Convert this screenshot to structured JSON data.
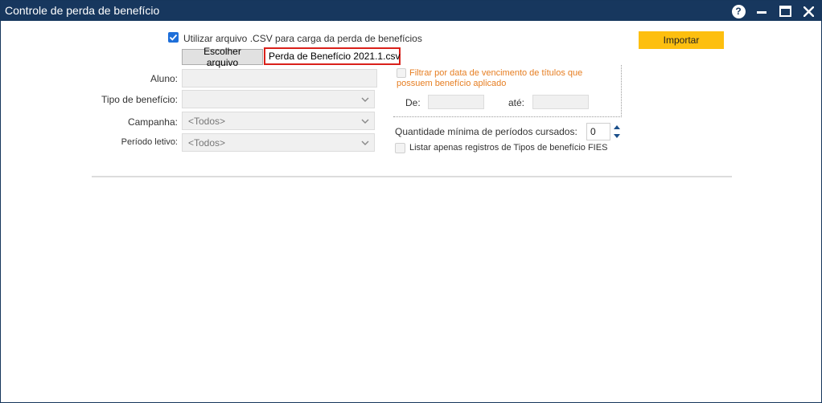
{
  "window": {
    "title": "Controle de perda de benefício"
  },
  "csv": {
    "use_csv_label": "Utilizar arquivo .CSV para carga da perda de benefícios",
    "use_csv_checked": true,
    "choose_button": "Escolher arquivo",
    "file_name": "Perda de Benefício 2021.1.csv"
  },
  "form": {
    "aluno_label": "Aluno:",
    "aluno_value": "",
    "tipo_label": "Tipo de benefício:",
    "tipo_value": "",
    "campanha_label": "Campanha:",
    "campanha_value": "<Todos>",
    "periodo_label": "Período letivo:",
    "periodo_value": "<Todos>"
  },
  "filter": {
    "label": "Filtrar por data de vencimento de títulos que possuem benefício aplicado",
    "de_label": "De:",
    "ate_label": "até:",
    "de_value": "",
    "ate_value": ""
  },
  "min_periods": {
    "label": "Quantidade mínima de períodos cursados:",
    "value": "0"
  },
  "fies": {
    "label": "Listar apenas registros de Tipos de benefício FIES"
  },
  "actions": {
    "import_label": "Importar"
  },
  "colors": {
    "titlebar": "#17375e",
    "accent": "#fdbf0f",
    "highlight_border": "#d9201a",
    "filter_text": "#e67e22"
  }
}
